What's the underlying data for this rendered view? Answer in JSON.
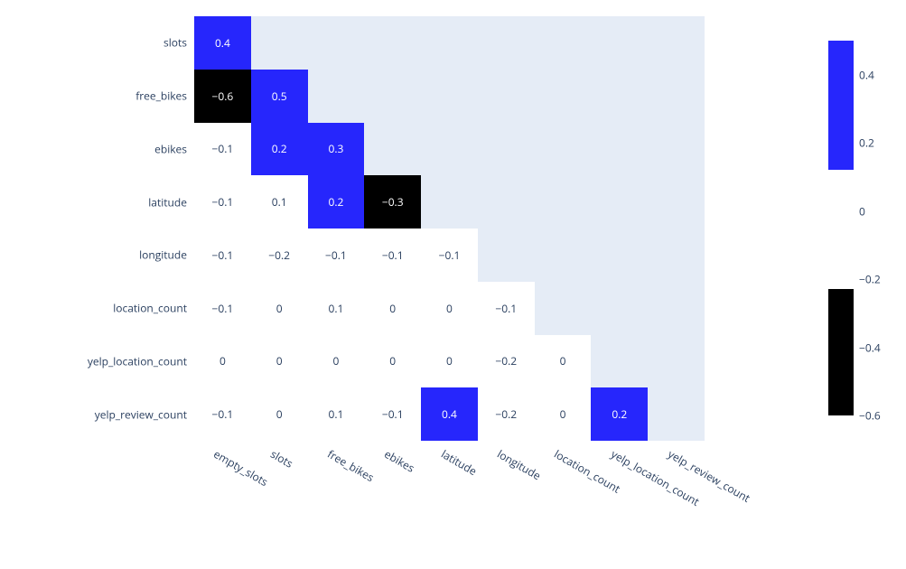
{
  "chart_data": {
    "type": "heatmap",
    "x_labels": [
      "empty_slots",
      "slots",
      "free_bikes",
      "ebikes",
      "latitude",
      "longitude",
      "location_count",
      "yelp_location_count",
      "yelp_review_count"
    ],
    "y_labels": [
      "slots",
      "free_bikes",
      "ebikes",
      "latitude",
      "longitude",
      "location_count",
      "yelp_location_count",
      "yelp_review_count"
    ],
    "matrix": [
      [
        0.4,
        null,
        null,
        null,
        null,
        null,
        null,
        null,
        null
      ],
      [
        -0.6,
        0.5,
        null,
        null,
        null,
        null,
        null,
        null,
        null
      ],
      [
        -0.1,
        0.2,
        0.3,
        null,
        null,
        null,
        null,
        null,
        null
      ],
      [
        -0.1,
        0.1,
        0.2,
        -0.3,
        null,
        null,
        null,
        null,
        null
      ],
      [
        -0.1,
        -0.2,
        -0.1,
        -0.1,
        -0.1,
        null,
        null,
        null,
        null
      ],
      [
        -0.1,
        0.0,
        0.1,
        0.0,
        0.0,
        -0.1,
        null,
        null,
        null
      ],
      [
        0.0,
        0.0,
        0.0,
        0.0,
        0.0,
        -0.2,
        0.0,
        null,
        null
      ],
      [
        -0.1,
        0.0,
        0.1,
        -0.1,
        0.4,
        -0.2,
        0.0,
        0.2,
        null
      ]
    ],
    "colorscale": {
      "zmin": -0.6,
      "zmax": 0.5,
      "ticks": [
        0.4,
        0.2,
        0,
        -0.2,
        -0.4,
        -0.6
      ]
    }
  }
}
